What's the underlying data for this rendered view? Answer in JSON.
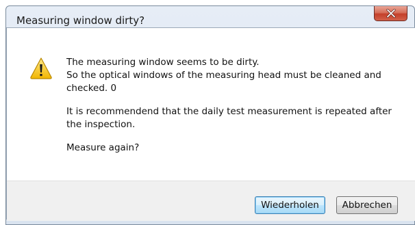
{
  "window": {
    "title": "Measuring window dirty?"
  },
  "icons": {
    "warning": "warning-triangle-icon",
    "close": "close-icon"
  },
  "message": {
    "line1": "The measuring window seems to be dirty.",
    "line2": "So the optical windows of the measuring head must be cleaned and",
    "line3": "checked. 0",
    "paragraph2_line1": "It is recommendend that the daily test measurement is repeated after",
    "paragraph2_line2": "the inspection.",
    "question": "Measure again?"
  },
  "buttons": {
    "retry_label": "Wiederholen",
    "cancel_label": "Abbrechen"
  },
  "colors": {
    "close_button": "#c4402a",
    "warning_fill": "#f6c21c",
    "default_button_border": "#3c7fb1"
  }
}
